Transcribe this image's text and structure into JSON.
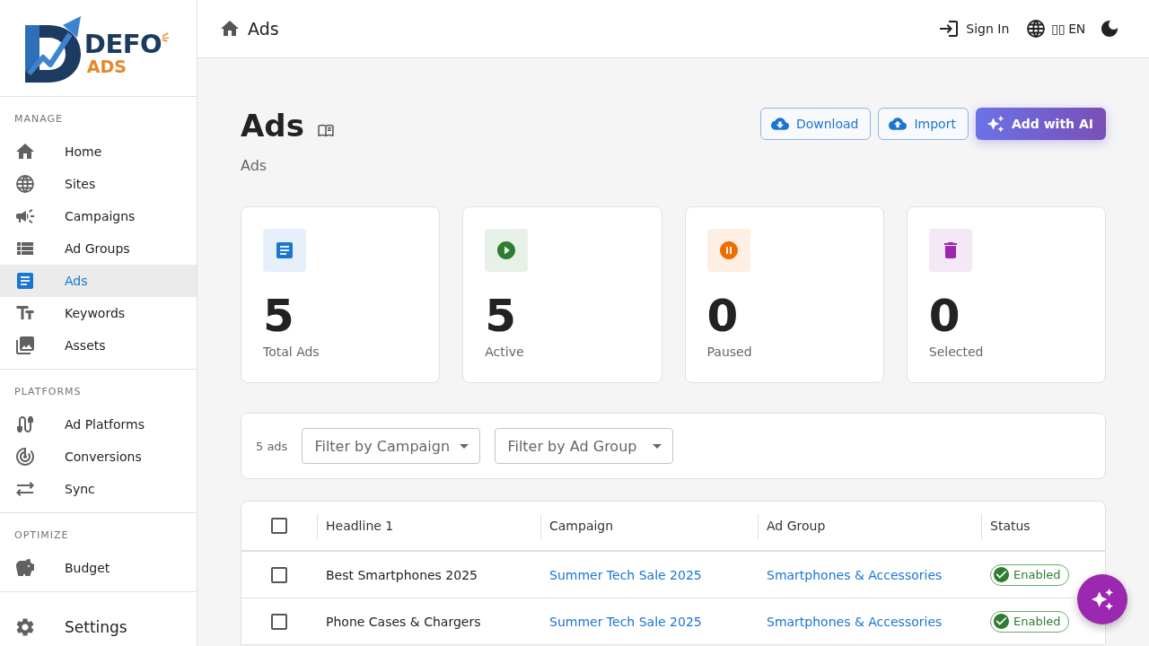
{
  "logo": {
    "name": "DEFO",
    "tagline": "ADS"
  },
  "sidebar": {
    "sections": [
      {
        "heading": "MANAGE",
        "items": [
          {
            "label": "Home",
            "selected": false
          },
          {
            "label": "Sites",
            "selected": false
          },
          {
            "label": "Campaigns",
            "selected": false
          },
          {
            "label": "Ad Groups",
            "selected": false
          },
          {
            "label": "Ads",
            "selected": true
          },
          {
            "label": "Keywords",
            "selected": false
          },
          {
            "label": "Assets",
            "selected": false
          }
        ]
      },
      {
        "heading": "PLATFORMS",
        "items": [
          {
            "label": "Ad Platforms",
            "selected": false
          },
          {
            "label": "Conversions",
            "selected": false
          },
          {
            "label": "Sync",
            "selected": false
          }
        ]
      },
      {
        "heading": "OPTIMIZE",
        "items": [
          {
            "label": "Budget",
            "selected": false
          }
        ]
      }
    ],
    "footer_item": {
      "label": "Settings",
      "selected": false
    }
  },
  "header": {
    "breadcrumb": "Ads",
    "sign_in": "Sign In",
    "language": "▯▯ EN"
  },
  "page": {
    "title": "Ads",
    "subtitle": "Ads",
    "actions": [
      {
        "label": "Download",
        "kind": "outlined"
      },
      {
        "label": "Import",
        "kind": "outlined"
      },
      {
        "label": "Add with AI",
        "kind": "gradient"
      }
    ]
  },
  "stats": [
    {
      "value": "5",
      "label": "Total Ads",
      "color": "#1976d2"
    },
    {
      "value": "5",
      "label": "Active",
      "color": "#2e7d32"
    },
    {
      "value": "0",
      "label": "Paused",
      "color": "#ef6c00"
    },
    {
      "value": "0",
      "label": "Selected",
      "color": "#9c27b0"
    }
  ],
  "filters": {
    "count": "5 ads",
    "selects": [
      {
        "label": "Filter by Campaign"
      },
      {
        "label": "Filter by Ad Group"
      }
    ]
  },
  "table": {
    "select_all_checked": false,
    "columns": [
      "Headline 1",
      "Campaign",
      "Ad Group",
      "Status"
    ],
    "rows": [
      {
        "checked": false,
        "headline": "Best Smartphones 2025",
        "campaign": "Summer Tech Sale 2025",
        "ad_group": "Smartphones & Accessories",
        "status": "Enabled"
      },
      {
        "checked": false,
        "headline": "Phone Cases & Chargers",
        "campaign": "Summer Tech Sale 2025",
        "ad_group": "Smartphones & Accessories",
        "status": "Enabled"
      }
    ]
  }
}
